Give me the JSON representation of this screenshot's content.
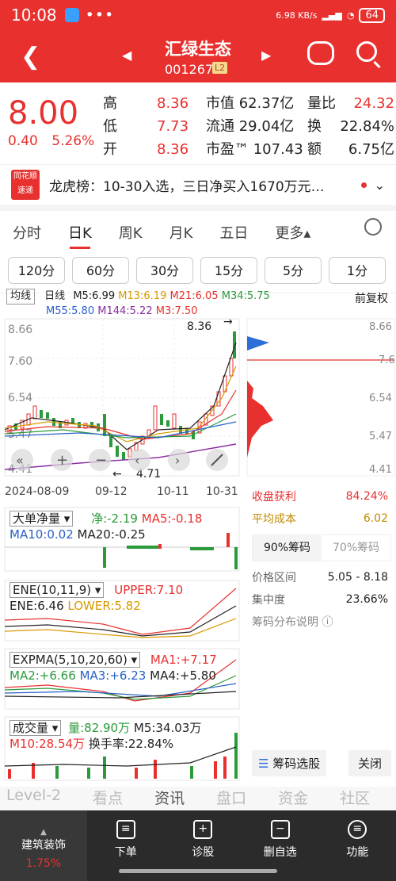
{
  "status": {
    "time": "10:08",
    "net": "6.98 KB/s",
    "battery": "64"
  },
  "header": {
    "name": "汇绿生态",
    "code": "001267",
    "level": "L2"
  },
  "quote": {
    "price": "8.00",
    "change": "0.40",
    "pct": "5.26%",
    "col1": [
      [
        "高",
        "8.36"
      ],
      [
        "低",
        "7.73"
      ],
      [
        "开",
        "8.36"
      ]
    ],
    "col2": [
      [
        "市值",
        "62.37亿"
      ],
      [
        "流通",
        "29.04亿"
      ],
      [
        "市盈™",
        "107.43"
      ]
    ],
    "col3": [
      [
        "量比",
        "24.32"
      ],
      [
        "换",
        "22.84%"
      ],
      [
        "额",
        "6.75亿"
      ]
    ]
  },
  "news": {
    "logo": "同花顺 速递",
    "text": "龙虎榜：10-30入选，三日净买入1670万元…"
  },
  "tabs": [
    "分时",
    "日K",
    "周K",
    "月K",
    "五日",
    "更多▴"
  ],
  "periods": [
    "120分",
    "60分",
    "30分",
    "15分",
    "5分",
    "1分"
  ],
  "ma": {
    "mode": "均线",
    "line": "日线",
    "m5": "M5:6.99",
    "m13": "M13:6.19",
    "m21": "M21:6.05",
    "m34": "M34:5.75",
    "m55": "M55:5.80",
    "m144": "M144:5.22",
    "m3": "M3:7.50",
    "adj": "前复权"
  },
  "main_chart": {
    "y_ticks": [
      "8.66",
      "7.60",
      "6.54",
      "5.47",
      "4.41"
    ],
    "x_ticks": [
      "2024-08-09",
      "09-12",
      "10-11",
      "10-31"
    ],
    "high_label": "8.36",
    "low_label": "4.71"
  },
  "chips": {
    "ticks": [
      "8.66",
      "7.6",
      "6.54",
      "5.47",
      "4.41"
    ],
    "profit_label": "收盘获利",
    "profit": "84.24%",
    "cost_label": "平均成本",
    "cost": "6.02",
    "seg": [
      "90%筹码",
      "70%筹码"
    ],
    "range_label": "价格区间",
    "range": "5.05 - 8.18",
    "conc_label": "集中度",
    "conc": "23.66%",
    "help": "筹码分布说明 ⓘ",
    "select": "筹码选股",
    "close": "关闭"
  },
  "ind1": {
    "name": "大单净量 ▾",
    "a": "净:-2.19",
    "b": "MA5:-0.18",
    "c": "MA10:0.02",
    "d": "MA20:-0.25"
  },
  "ind2": {
    "name": "ENE(10,11,9) ▾",
    "a": "UPPER:7.10",
    "b": "ENE:6.46",
    "c": "LOWER:5.82"
  },
  "ind3": {
    "name": "EXPMA(5,10,20,60) ▾",
    "a": "MA1:+7.17",
    "b": "MA2:+6.66",
    "c": "MA3:+6.23",
    "d": "MA4:+5.80"
  },
  "ind4": {
    "name": "成交量 ▾",
    "a": "量:82.90万",
    "b": "M5:34.03万",
    "c": "M10:28.54万",
    "d": "换手率:22.84%"
  },
  "scroll_tabs": [
    "Level-2",
    "看点",
    "资讯",
    "盘口",
    "资金",
    "社区"
  ],
  "bottom": {
    "sector": "建筑装饰",
    "sector_pct": "1.75%",
    "buttons": [
      "下单",
      "诊股",
      "删自选",
      "功能"
    ]
  }
}
